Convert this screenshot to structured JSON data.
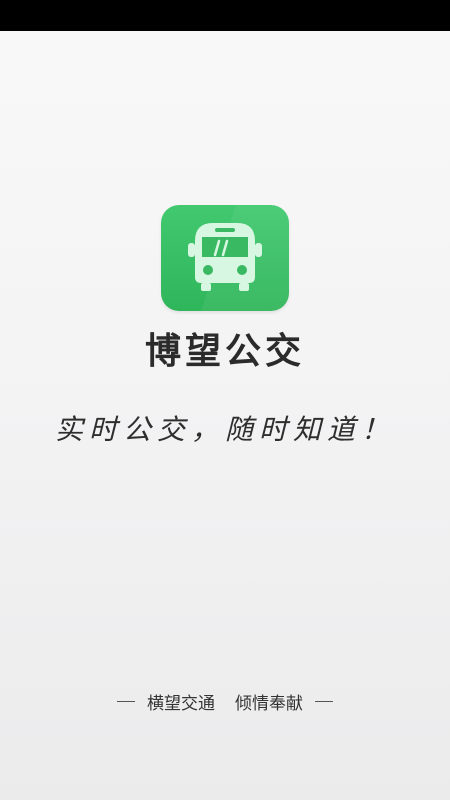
{
  "app": {
    "name": "博望公交",
    "icon": "bus-icon",
    "accent_color": "#3ac064"
  },
  "slogan": "实时公交，随时知道！",
  "footer": {
    "left_text": "横望交通",
    "right_text": "倾情奉献"
  }
}
